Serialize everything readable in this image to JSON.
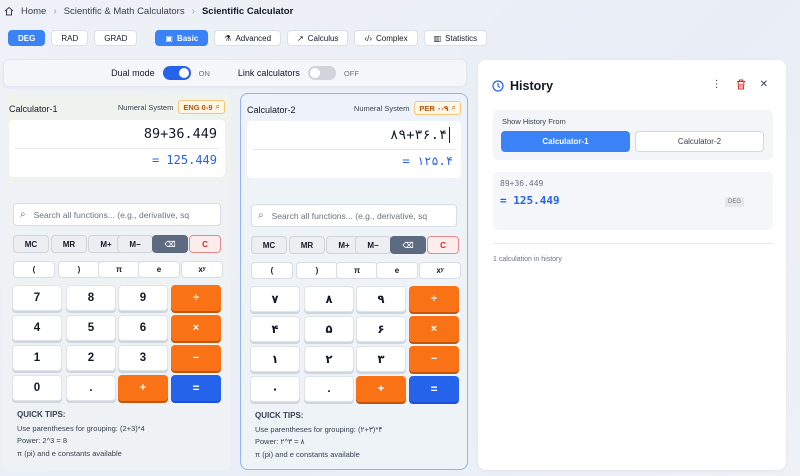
{
  "breadcrumb": {
    "home": "Home",
    "section": "Scientific & Math Calculators",
    "current": "Scientific Calculator"
  },
  "toolbar": {
    "angle_modes": [
      "DEG",
      "RAD",
      "GRAD"
    ],
    "active_angle": "DEG",
    "tabs": [
      {
        "label": "Basic",
        "icon": "calculator-icon",
        "glyph": "▣"
      },
      {
        "label": "Advanced",
        "icon": "flask-icon",
        "glyph": "⚗"
      },
      {
        "label": "Calculus",
        "icon": "trend-icon",
        "glyph": "↗"
      },
      {
        "label": "Complex",
        "icon": "code-icon",
        "glyph": "‹/›"
      },
      {
        "label": "Statistics",
        "icon": "chart-icon",
        "glyph": "▥"
      }
    ],
    "active_tab": "Basic"
  },
  "dual": {
    "dual_label": "Dual mode",
    "dual_state": "ON",
    "link_label": "Link calculators",
    "link_state": "OFF"
  },
  "calc1": {
    "title": "Calculator-1",
    "numeral_label": "Numeral System",
    "numeral_value": "ENG 0-9",
    "expression": "89+36.449",
    "result": "= 125.449",
    "search_placeholder": "Search all functions... (e.g., derivative, sq",
    "memory_keys": [
      "MC",
      "MR",
      "M+",
      "M−"
    ],
    "clear_key": "C",
    "func_keys": [
      "(",
      ")",
      "π",
      "e",
      "xʸ"
    ],
    "num_rows": [
      [
        "7",
        "8",
        "9"
      ],
      [
        "4",
        "5",
        "6"
      ],
      [
        "1",
        "2",
        "3"
      ],
      [
        "0",
        "."
      ]
    ],
    "ops": [
      "÷",
      "×",
      "−",
      "+"
    ],
    "equals": "=",
    "tips_title": "QUICK TIPS:",
    "tips": [
      "Use parentheses for grouping: (2+3)*4",
      "Power: 2^3 = 8",
      "π (pi) and e constants available"
    ]
  },
  "calc2": {
    "title": "Calculator-2",
    "numeral_label": "Numeral System",
    "numeral_value": "PER ۰-۹",
    "expression": "۸۹+۳۶.۴",
    "result": "= ۱۲۵.۴",
    "search_placeholder": "Search all functions... (e.g., derivative, sq",
    "memory_keys": [
      "MC",
      "MR",
      "M+",
      "M−"
    ],
    "clear_key": "C",
    "func_keys": [
      "(",
      ")",
      "π",
      "e",
      "xʸ"
    ],
    "num_rows": [
      [
        "۷",
        "۸",
        "۹"
      ],
      [
        "۴",
        "۵",
        "۶"
      ],
      [
        "۱",
        "۲",
        "۳"
      ],
      [
        "۰",
        "."
      ]
    ],
    "ops": [
      "÷",
      "×",
      "−",
      "+"
    ],
    "equals": "=",
    "tips_title": "QUICK TIPS:",
    "tips": [
      "Use parentheses for grouping: (۲+۳)*۴",
      "Power: ۲^۳ = ۸",
      "π (pi) and e constants available"
    ]
  },
  "history": {
    "title": "History",
    "show_from_label": "Show History From",
    "sources": [
      "Calculator-1",
      "Calculator-2"
    ],
    "active_source": "Calculator-1",
    "entry_expression": "89+36.449",
    "entry_result": "= 125.449",
    "entry_mode": "DEG",
    "count_text": "1 calculation in history"
  },
  "colors": {
    "accent": "#3b82f6",
    "operator": "#f97316",
    "equals": "#2563eb",
    "danger": "#dc2626"
  }
}
